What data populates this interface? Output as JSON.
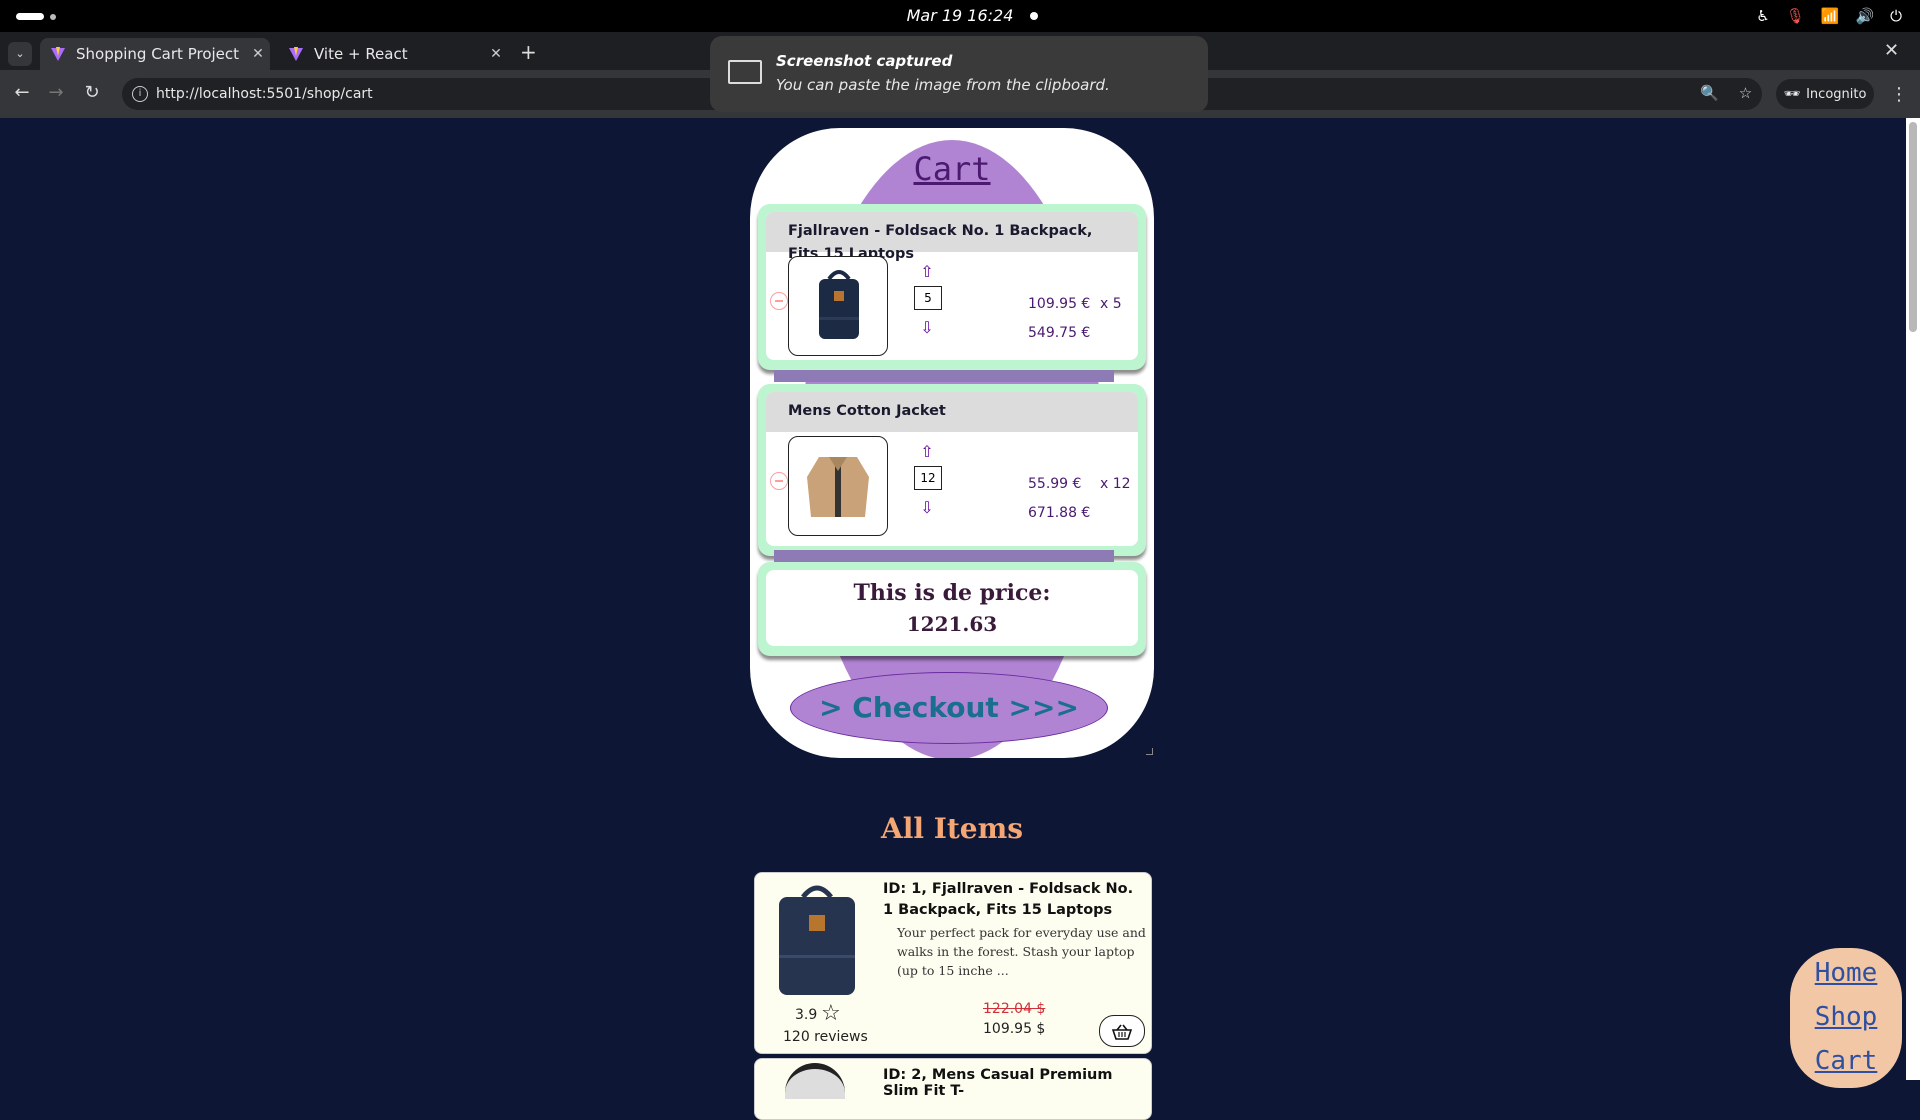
{
  "system": {
    "datetime": "Mar 19  16:24"
  },
  "browser": {
    "tabs": [
      {
        "title": "Shopping Cart Project",
        "active": true
      },
      {
        "title": "Vite + React",
        "active": false
      }
    ],
    "url": "http://localhost:5501/shop/cart",
    "incognito_label": "Incognito"
  },
  "toast": {
    "title": "Screenshot captured",
    "body": "You can paste the image from the clipboard."
  },
  "cart": {
    "title": "Cart",
    "items": [
      {
        "name": "Fjallraven - Foldsack No. 1 Backpack, Fits 15 Laptops",
        "quantity": "5",
        "unit_price": "109.95 €",
        "times": "x  5",
        "line_total": "549.75 €"
      },
      {
        "name": "Mens Cotton Jacket",
        "quantity": "12",
        "unit_price": "55.99 €",
        "times": "x  12",
        "line_total": "671.88 €"
      }
    ],
    "total_label": "This is de price:",
    "total_value": "1221.63",
    "checkout_label": "> Checkout >>>"
  },
  "all_items": {
    "title": "All Items",
    "products": [
      {
        "title": "ID: 1, Fjallraven - Foldsack No. 1 Backpack, Fits 15 Laptops",
        "description": "Your perfect pack for everyday use and walks in the forest. Stash your laptop (up to 15 inche ...",
        "rating": "3.9",
        "reviews": "120 reviews",
        "old_price": "122.04 $",
        "new_price": "109.95 $"
      },
      {
        "title": "ID: 2, Mens Casual Premium Slim Fit T-"
      }
    ]
  },
  "nav": {
    "home": "Home",
    "shop": "Shop",
    "cart": "Cart"
  },
  "colors": {
    "page_bg": "#0d1635",
    "cart_oval": "#b084d2",
    "item_border": "#bdf5d1",
    "all_items_title": "#f4a774",
    "nav_bubble": "#f2c7a6"
  }
}
